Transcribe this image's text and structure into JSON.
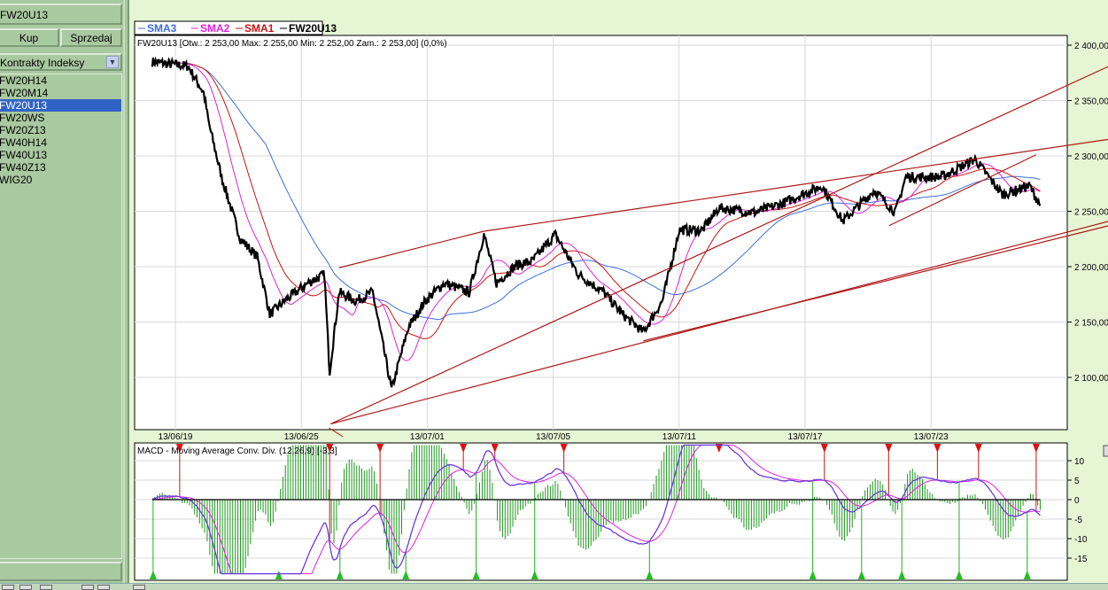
{
  "left": {
    "instrument": "FW20U13",
    "buy_label": "Kup",
    "sell_label": "Sprzedaj",
    "category": "Kontrakty Indeksy",
    "items": [
      "FW20H14",
      "FW20M14",
      "FW20U13",
      "FW20WS",
      "FW20Z13",
      "FW40H14",
      "FW40U13",
      "FW40Z13",
      "WIG20"
    ],
    "selected_index": 2
  },
  "chart_data": [
    {
      "type": "line",
      "title": "FW20U13 [Otw.: 2 253,00  Max: 2 255,00  Min: 2 252,00  Zam.: 2 253,00] (0,0%)",
      "legend": [
        {
          "name": "SMA3",
          "color": "#3a6fe0"
        },
        {
          "name": "SMA2",
          "color": "#e020e0"
        },
        {
          "name": "SMA1",
          "color": "#d01010"
        },
        {
          "name": "FW20U13",
          "color": "#000000"
        }
      ],
      "legend_placement": "top-left",
      "x_ticks": [
        {
          "x": 0,
          "label": "13/06/19"
        },
        {
          "x": 6,
          "label": "13/06/25"
        },
        {
          "x": 12,
          "label": "13/07/01"
        },
        {
          "x": 18,
          "label": "13/07/05"
        },
        {
          "x": 24,
          "label": "13/07/11"
        },
        {
          "x": 30,
          "label": "13/07/17"
        },
        {
          "x": 36,
          "label": "13/07/23"
        }
      ],
      "y_ticks": [
        {
          "v": 2400,
          "label": "2 400,00"
        },
        {
          "v": 2350,
          "label": "2 350,00"
        },
        {
          "v": 2300,
          "label": "2 300,00"
        },
        {
          "v": 2250,
          "label": "2 250,00"
        },
        {
          "v": 2200,
          "label": "2 200,00"
        },
        {
          "v": 2150,
          "label": "2 150,00"
        },
        {
          "v": 2100,
          "label": "2 100,00"
        }
      ],
      "xlim": [
        -2.2,
        42.2
      ],
      "ylim": [
        2050,
        2410
      ],
      "price": [
        [
          -1.1,
          2385
        ],
        [
          0.6,
          2381
        ],
        [
          1.35,
          2357
        ],
        [
          1.6,
          2329
        ],
        [
          2.2,
          2281
        ],
        [
          3.1,
          2225
        ],
        [
          3.9,
          2209
        ],
        [
          4.5,
          2157
        ],
        [
          5.2,
          2169
        ],
        [
          6.3,
          2185
        ],
        [
          7.1,
          2193
        ],
        [
          7.35,
          2105
        ],
        [
          7.8,
          2177
        ],
        [
          8.6,
          2169
        ],
        [
          9.4,
          2177
        ],
        [
          10.3,
          2089
        ],
        [
          11.1,
          2145
        ],
        [
          11.9,
          2169
        ],
        [
          12.8,
          2185
        ],
        [
          14.0,
          2177
        ],
        [
          14.7,
          2229
        ],
        [
          15.3,
          2185
        ],
        [
          16.2,
          2201
        ],
        [
          17.0,
          2205
        ],
        [
          18.1,
          2229
        ],
        [
          19.2,
          2193
        ],
        [
          20.4,
          2177
        ],
        [
          21.3,
          2157
        ],
        [
          22.3,
          2141
        ],
        [
          23.2,
          2169
        ],
        [
          24.0,
          2233
        ],
        [
          25.1,
          2233
        ],
        [
          25.9,
          2253
        ],
        [
          27.6,
          2249
        ],
        [
          28.9,
          2257
        ],
        [
          30.8,
          2273
        ],
        [
          31.8,
          2241
        ],
        [
          33.3,
          2269
        ],
        [
          34.3,
          2249
        ],
        [
          34.8,
          2281
        ],
        [
          36.5,
          2281
        ],
        [
          38.1,
          2297
        ],
        [
          39.4,
          2265
        ],
        [
          40.7,
          2273
        ],
        [
          41.2,
          2255
        ]
      ],
      "sma_periods": {
        "SMA1": 20,
        "SMA2": 10,
        "SMA3": 45
      },
      "trendlines": [
        [
          [
            7.4,
            2058
          ],
          [
            44.5,
            2381
          ]
        ],
        [
          [
            7.8,
            2199
          ],
          [
            14.7,
            2232
          ]
        ],
        [
          [
            14.7,
            2232
          ],
          [
            44.5,
            2315
          ]
        ],
        [
          [
            7.4,
            2058
          ],
          [
            44.5,
            2241
          ]
        ],
        [
          [
            22.3,
            2133
          ],
          [
            44.5,
            2237
          ]
        ],
        [
          [
            34.0,
            2237
          ],
          [
            41.0,
            2301
          ]
        ]
      ]
    },
    {
      "type": "line",
      "title": "MACD - Moving Average Conv. Div. (12,26,9) [-3,3]",
      "y_ticks": [
        {
          "v": 10,
          "label": "10"
        },
        {
          "v": 5,
          "label": "5"
        },
        {
          "v": 0,
          "label": "0"
        },
        {
          "v": -5,
          "label": "-5"
        },
        {
          "v": -10,
          "label": "-10"
        },
        {
          "v": -15,
          "label": "-15"
        }
      ],
      "ylim": [
        -19,
        14
      ],
      "params": [
        12,
        26,
        9
      ],
      "band": [
        -3,
        3
      ]
    }
  ]
}
